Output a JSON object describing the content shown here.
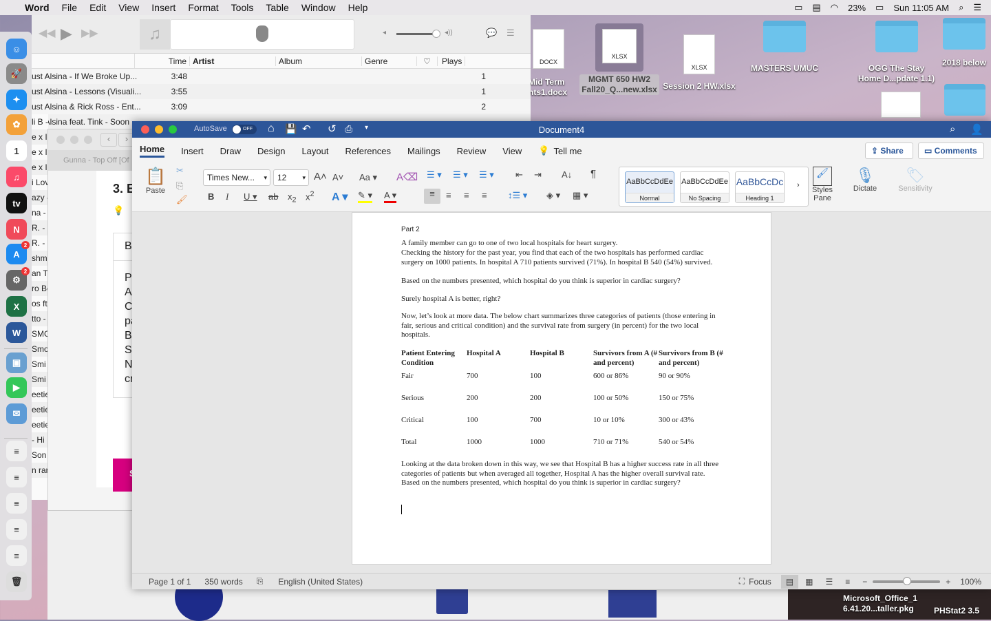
{
  "menubar": {
    "app": "Word",
    "items": [
      "File",
      "Edit",
      "View",
      "Insert",
      "Format",
      "Tools",
      "Table",
      "Window",
      "Help"
    ],
    "battery": "23%",
    "clock": "Sun 11:05 AM"
  },
  "desktop": {
    "items": [
      {
        "label": "Mid Term\nnts1.docx",
        "type": "DOCX"
      },
      {
        "label": "MGMT 650 HW2\nFall20_Q...new.xlsx",
        "type": "XLSX"
      },
      {
        "label": "Session 2 HW.xlsx",
        "type": "XLSX"
      },
      {
        "label": "MASTERS UMUC",
        "type": "folder"
      },
      {
        "label": "OGG The Stay\nHome D...pdate 1.1)",
        "type": "folder"
      },
      {
        "label": "2018 below",
        "type": "folder"
      },
      {
        "label": "Microsoft_Office_1\n6.41.20...taller.pkg",
        "type": "pkg"
      },
      {
        "label": "PHStat2 3.5",
        "type": "folder"
      }
    ]
  },
  "dock": {
    "items": [
      {
        "name": "finder",
        "glyph": "☺",
        "color": "#3a8ee6"
      },
      {
        "name": "launchpad",
        "glyph": "🚀",
        "color": "#8a8a8a"
      },
      {
        "name": "safari",
        "glyph": "✦",
        "color": "#1d8ff0"
      },
      {
        "name": "photos",
        "glyph": "✿",
        "color": "#f3a13a"
      },
      {
        "name": "calendar",
        "glyph": "1",
        "color": "#ffffff"
      },
      {
        "name": "music",
        "glyph": "♫",
        "color": "#fb4a69"
      },
      {
        "name": "apple-tv",
        "glyph": "tv",
        "color": "#111111"
      },
      {
        "name": "news",
        "glyph": "N",
        "color": "#f04a5a"
      },
      {
        "name": "app-store",
        "glyph": "A",
        "color": "#1c8af0",
        "badge": "2"
      },
      {
        "name": "system-preferences",
        "glyph": "⚙",
        "color": "#666666",
        "badge": "2"
      },
      {
        "name": "excel",
        "glyph": "X",
        "color": "#1e7145"
      },
      {
        "name": "word",
        "glyph": "W",
        "color": "#2b579a"
      },
      {
        "name": "preview",
        "glyph": "▣",
        "color": "#6aa0d0"
      },
      {
        "name": "facetime",
        "glyph": "▶",
        "color": "#34c759"
      },
      {
        "name": "mail",
        "glyph": "✉",
        "color": "#5d9bd6"
      },
      {
        "name": "document-1",
        "glyph": "≡",
        "color": "#f0f0f0"
      },
      {
        "name": "document-2",
        "glyph": "≡",
        "color": "#f0f0f0"
      },
      {
        "name": "document-3",
        "glyph": "≡",
        "color": "#f0f0f0"
      },
      {
        "name": "document-4",
        "glyph": "≡",
        "color": "#f0f0f0"
      },
      {
        "name": "document-5",
        "glyph": "≡",
        "color": "#f0f0f0"
      },
      {
        "name": "trash",
        "glyph": "🗑",
        "color": "#dddddd"
      }
    ]
  },
  "itunes": {
    "columns": [
      "Time",
      "Artist",
      "Album",
      "Genre",
      "♡",
      "Plays"
    ],
    "rows": [
      {
        "title": "ust Alsina - If We Broke Up...",
        "time": "3:48",
        "plays": "1"
      },
      {
        "title": "ust Alsina - Lessons (Visuali...",
        "time": "3:55",
        "plays": "1"
      },
      {
        "title": "ust Alsina & Rick Ross - Ent...",
        "time": "3:09",
        "plays": "2"
      },
      {
        "title": "ust Alsina feat. Tink - Soon",
        "time": "",
        "plays": ""
      }
    ],
    "fragments": [
      "li B -",
      "e x I",
      "e x I",
      "e x I",
      "i Lov",
      "azy -",
      "na -",
      "R. -",
      "R. -",
      "shme",
      "an T",
      "ro Bo",
      "os ft.",
      "tto -",
      "SMG",
      "Smo",
      "Smi",
      "Smi",
      "eetie",
      "eetie",
      "eetie",
      "- Hi",
      "Son",
      "n rar"
    ]
  },
  "browser": {
    "tab": "Gunna - Top Off [Of",
    "heading": "3. E",
    "box_title": "B",
    "lines": [
      "Pa",
      "A",
      "C",
      "pa",
      "Ba",
      "Sı",
      "N",
      "cr"
    ],
    "button": "S"
  },
  "word": {
    "title": "Document4",
    "autosave": "AutoSave",
    "autosave_state": "OFF",
    "tabs": [
      "Home",
      "Insert",
      "Draw",
      "Design",
      "Layout",
      "References",
      "Mailings",
      "Review",
      "View",
      "Tell me"
    ],
    "share": "Share",
    "comments": "Comments",
    "ribbon": {
      "paste": "Paste",
      "font": "Times New...",
      "size": "12",
      "change_case": "Aa",
      "styles": [
        {
          "preview": "AaBbCcDdEe",
          "label": "Normal"
        },
        {
          "preview": "AaBbCcDdEe",
          "label": "No Spacing"
        },
        {
          "preview": "AaBbCcDc",
          "label": "Heading 1"
        }
      ],
      "styles_pane": "Styles\nPane",
      "dictate": "Dictate",
      "sensitivity": "Sensitivity"
    },
    "document": {
      "heading": "Part 2",
      "p1": "A family member can go to one of two local hospitals for heart surgery.",
      "p2": "Checking the history for the past year, you find that each of the two hospitals has performed cardiac surgery on 1000 patients. In hospital A 710 patients survived (71%). In hospital B 540 (54%) survived.",
      "p3": "Based on the numbers presented, which hospital do you think is superior in cardiac surgery?",
      "p4": "Surely hospital A is better, right?",
      "p5": "Now, let’s look at more data. The below chart summarizes three categories of patients (those entering in fair, serious and critical condition) and the survival rate from surgery (in percent) for the two local hospitals.",
      "table": {
        "headers": [
          "Patient Entering Condition",
          "Hospital A",
          "Hospital B",
          "Survivors from A (# and percent)",
          "Survivors from B (# and percent)"
        ],
        "rows": [
          [
            "Fair",
            "700",
            "100",
            "600 or 86%",
            "90 or 90%"
          ],
          [
            "Serious",
            "200",
            "200",
            "100 or 50%",
            "150 or 75%"
          ],
          [
            "Critical",
            "100",
            "700",
            "10 or 10%",
            "300 or 43%"
          ],
          [
            "Total",
            "1000",
            "1000",
            "710 or 71%",
            "540 or 54%"
          ]
        ]
      },
      "p6": "Looking at the data broken down in this way, we see that Hospital B has a higher success rate in all three categories of patients but when averaged all together, Hospital A has the higher overall survival rate. Based on the numbers presented, which hospital do you think is superior in cardiac surgery?"
    },
    "status": {
      "page": "Page 1 of 1",
      "words": "350 words",
      "language": "English (United States)",
      "focus": "Focus",
      "zoom": "100%",
      "zoom_level": 100
    }
  }
}
